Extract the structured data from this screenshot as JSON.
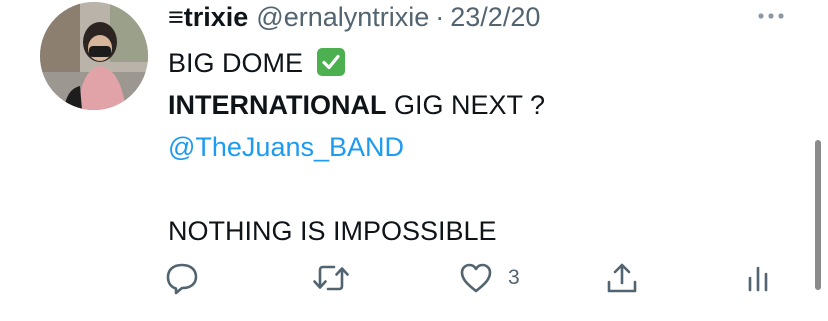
{
  "tweet": {
    "name": "≡trixie",
    "handle": "@ernalyntrixie",
    "separator": "·",
    "date": "23/2/20",
    "lines": {
      "l1": "BIG DOME",
      "l2_bold": "INTERNATIONAL",
      "l2_rest": " GIG NEXT ?",
      "l3_link": "@TheJuans_BAND",
      "l5": "NOTHING IS IMPOSSIBLE"
    },
    "emoji": "check-mark-button",
    "like_count": "3"
  },
  "icons": {
    "more": "more-horizontal-icon",
    "reply": "reply-icon",
    "retweet": "retweet-icon",
    "like": "heart-icon",
    "share": "share-icon",
    "analytics": "analytics-icon"
  },
  "colors": {
    "text": "#0f1419",
    "secondary": "#536471",
    "link": "#1d9bf0",
    "check_green": "#4caf50"
  }
}
